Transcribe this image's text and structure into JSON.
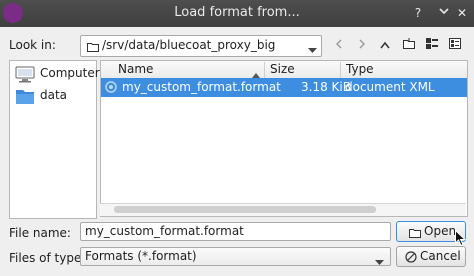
{
  "window": {
    "title": "Load format from..."
  },
  "titlebar": {
    "help_icon": "?",
    "close_icon": "✕"
  },
  "look_in": {
    "label": "Look in:",
    "path": "/srv/data/bluecoat_proxy_big"
  },
  "sidebar": {
    "items": [
      {
        "label": "Computer",
        "icon": "computer-icon"
      },
      {
        "label": "data",
        "icon": "folder-icon"
      }
    ]
  },
  "table": {
    "columns": [
      "Name",
      "Size",
      "Type"
    ],
    "rows": [
      {
        "name": "my_custom_format.format",
        "size": "3.18 KiB",
        "type": "document XML"
      }
    ]
  },
  "filename": {
    "label": "File name:",
    "value": "my_custom_format.format"
  },
  "filetype": {
    "label": "Files of type:",
    "value": "Formats (*.format)"
  },
  "buttons": {
    "open": "Open",
    "cancel": "Cancel"
  },
  "colors": {
    "accent": "#3d8ee0",
    "titlebar": "#474747",
    "app_icon": "#7a2c86"
  }
}
